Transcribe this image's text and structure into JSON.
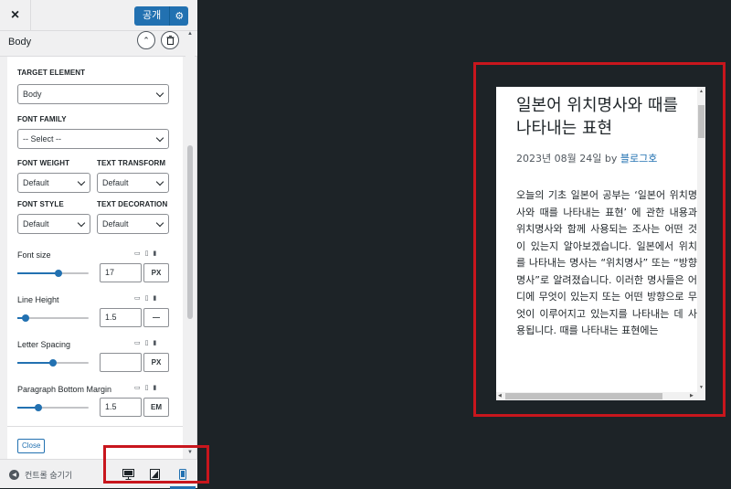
{
  "topbar": {
    "close_icon": "×",
    "publish_label": "공개",
    "settings_icon": "⚙"
  },
  "section": {
    "title": "Body",
    "collapse_icon": "⌃",
    "delete_icon": "🗑"
  },
  "fields": {
    "target_element": {
      "label": "TARGET ELEMENT",
      "value": "Body"
    },
    "font_family": {
      "label": "FONT FAMILY",
      "value": "-- Select --"
    },
    "font_weight": {
      "label": "FONT WEIGHT",
      "value": "Default"
    },
    "text_transform": {
      "label": "TEXT TRANSFORM",
      "value": "Default"
    },
    "font_style": {
      "label": "FONT STYLE",
      "value": "Default"
    },
    "text_decoration": {
      "label": "TEXT DECORATION",
      "value": "Default"
    }
  },
  "sliders": {
    "font_size": {
      "label": "Font size",
      "value": "17",
      "unit": "PX",
      "position": 0.58
    },
    "line_height": {
      "label": "Line Height",
      "value": "1.5",
      "unit": "—",
      "position": 0.12
    },
    "letter_spacing": {
      "label": "Letter Spacing",
      "value": "",
      "unit": "PX",
      "position": 0.5
    },
    "paragraph_margin": {
      "label": "Paragraph Bottom Margin",
      "value": "1.5",
      "unit": "EM",
      "position": 0.3
    }
  },
  "close_label": "Close",
  "footer": {
    "hide_controls": "컨트롤 숨기기",
    "devices": [
      "desktop",
      "tablet",
      "mobile"
    ],
    "active_device": "mobile"
  },
  "preview": {
    "title": "일본어 위치명사와 때를 나타내는 표현",
    "date": "2023년 08월 24일",
    "by": "by",
    "author": "블로그호",
    "body": "오늘의 기초 일본어 공부는 ‘일본어 위치명사와 때를 나타내는 표현’ 에 관한 내용과 위치명사와 함께 사용되는 조사는 어떤 것이 있는지 알아보겠습니다. 일본에서 위치를 나타내는 명사는 “위치명사” 또는 “방향명사”로 알려졌습니다. 이러한 명사들은 어디에 무엇이 있는지 또는 어떤 방향으로 무엇이 이루어지고 있는지를 나타내는 데 사용됩니다. 때를 나타내는 표현에는"
  },
  "colors": {
    "accent": "#2271b1",
    "highlight": "#c8161d",
    "background": "#1d2327"
  }
}
